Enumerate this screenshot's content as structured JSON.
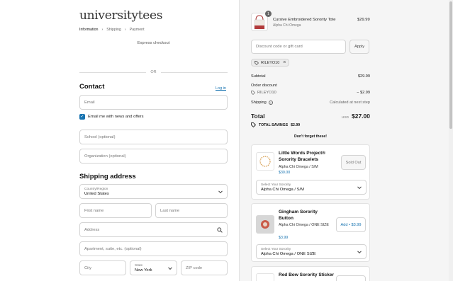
{
  "brand": {
    "logo_text": "universitytees"
  },
  "breadcrumb": {
    "items": [
      "Information",
      "Shipping",
      "Payment"
    ],
    "separator": "›"
  },
  "express": {
    "label": "Express checkout"
  },
  "divider": {
    "label": "OR"
  },
  "contact": {
    "title": "Contact",
    "login_link": "Log in",
    "email_placeholder": "Email",
    "newsletter_label": "Email me with news and offers",
    "newsletter_checked": true,
    "school_placeholder": "School (optional)",
    "organization_placeholder": "Organization (optional)"
  },
  "shipping": {
    "title": "Shipping address",
    "country_label": "Country/Region",
    "country_value": "United States",
    "first_name_placeholder": "First name",
    "last_name_placeholder": "Last name",
    "address_placeholder": "Address",
    "apartment_placeholder": "Apartment, suite, etc. (optional)",
    "city_placeholder": "City",
    "state_label": "State",
    "state_value": "New York",
    "zip_placeholder": "ZIP code"
  },
  "cart": {
    "item": {
      "name": "Cursive Embroidered Sorority Tote",
      "variant": "Alpha Chi Omega",
      "price": "$29.99",
      "quantity": "1"
    },
    "discount_placeholder": "Discount code or gift card",
    "apply_label": "Apply",
    "applied_code": "RILEYO10",
    "subtotal_label": "Subtotal",
    "subtotal_value": "$29.99",
    "order_discount_label": "Order discount",
    "discount_code": "RILEYO10",
    "discount_value": "− $2.99",
    "shipping_label": "Shipping",
    "shipping_value": "Calculated at next step",
    "total_label": "Total",
    "currency": "USD",
    "total_value": "$27.00",
    "savings_label": "TOTAL SAVINGS",
    "savings_value": "$2.99"
  },
  "upsell": {
    "title": "Don't forget these!",
    "items": [
      {
        "name": "Little Words Project® Sorority Bracelets",
        "variant": "Alpha Chi Omega / S/M",
        "price": "$30.00",
        "action": "Sold Out",
        "select_label": "Select Your Sorority",
        "select_value": "Alpha Chi Omega / S/M"
      },
      {
        "name": "Gingham Sorority Button",
        "variant": "Alpha Chi Omega / ONE SIZE",
        "price": "$3.99",
        "action": "Add • $3.99",
        "select_label": "Select Your Sorority",
        "select_value": "Alpha Chi Omega / ONE SIZE"
      },
      {
        "name": "Red Bow Sorority Sticker"
      }
    ]
  },
  "colors": {
    "accent": "#1773b0",
    "link": "#1773b0",
    "panel_bg": "#f5f5f5"
  }
}
